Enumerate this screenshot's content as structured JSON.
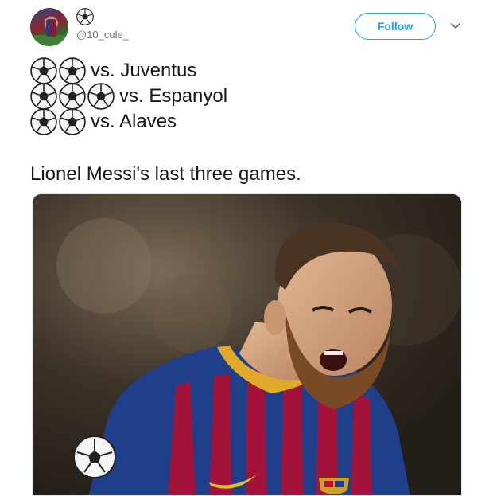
{
  "user": {
    "name_icon": "soccer-ball-icon",
    "handle": "@10_cule_",
    "follow_label": "Follow"
  },
  "tweet": {
    "lines": [
      {
        "balls": 2,
        "text": "vs. Juventus"
      },
      {
        "balls": 3,
        "text": "vs. Espanyol"
      },
      {
        "balls": 2,
        "text": "vs. Alaves"
      }
    ],
    "caption": "Lionel Messi's last three games."
  },
  "colors": {
    "accent": "#1da1f2",
    "text": "#14171a",
    "muted": "#657786",
    "jersey_blue": "#1f3f8a",
    "jersey_red": "#a3123a"
  }
}
